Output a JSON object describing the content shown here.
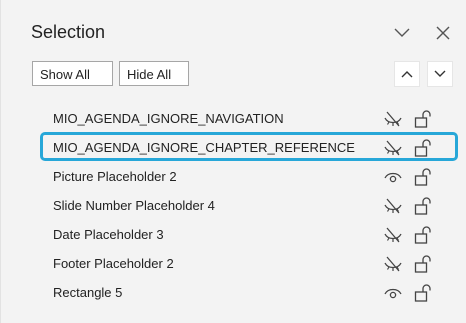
{
  "pane": {
    "title": "Selection",
    "show_all_label": "Show All",
    "hide_all_label": "Hide All"
  },
  "rows": [
    {
      "label": "MIO_AGENDA_IGNORE_NAVIGATION",
      "visible": false,
      "icon": "eye-hidden-icon"
    },
    {
      "label": "MIO_AGENDA_IGNORE_CHAPTER_REFERENCE",
      "visible": false,
      "icon": "eye-hidden-icon",
      "highlighted": true
    },
    {
      "label": "Picture Placeholder 2",
      "visible": true,
      "icon": "eye-icon"
    },
    {
      "label": "Slide Number Placeholder 4",
      "visible": false,
      "icon": "eye-hidden-icon"
    },
    {
      "label": "Date Placeholder 3",
      "visible": false,
      "icon": "eye-hidden-icon"
    },
    {
      "label": "Footer Placeholder 2",
      "visible": false,
      "icon": "eye-hidden-icon"
    },
    {
      "label": "Rectangle 5",
      "visible": true,
      "icon": "eye-icon"
    }
  ],
  "colors": {
    "highlight": "#27a7d8",
    "pane_bg": "#f3f3f3"
  }
}
